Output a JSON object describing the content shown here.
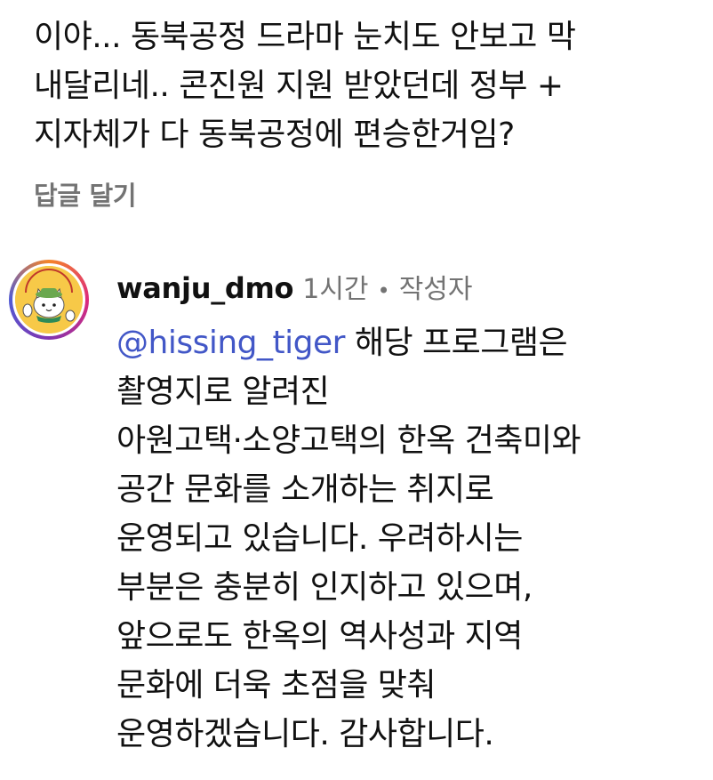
{
  "parent_comment": {
    "lines": [
      "이야... 동북공정 드라마 눈치도 안보고 막",
      "내달리네.. 콘진원 지원 받았던데 정부 +",
      "지자체가 다 동북공정에 편승한거임?"
    ],
    "reply_label": "답글 달기"
  },
  "reply": {
    "avatar_icon": "mascot-avatar-icon",
    "username": "wanju_dmo",
    "time": "1시간",
    "separator": "•",
    "author_tag": "작성자",
    "mention": "@hissing_tiger",
    "first_line_rest": " 해당 프로그램은",
    "lines": [
      "촬영지로 알려진",
      "아원고택·소양고택의 한옥 건축미와",
      "공간 문화를 소개하는 취지로",
      "운영되고 있습니다. 우려하시는",
      "부분은 충분히 인지하고 있으며,",
      "앞으로도 한옥의 역사성과 지역",
      "문화에 더욱 초점을 맞춰",
      "운영하겠습니다. 감사합니다."
    ]
  },
  "colors": {
    "text": "#111111",
    "secondary": "#737373",
    "mention": "#4257c7",
    "avatar_bg": "#f7c948"
  }
}
